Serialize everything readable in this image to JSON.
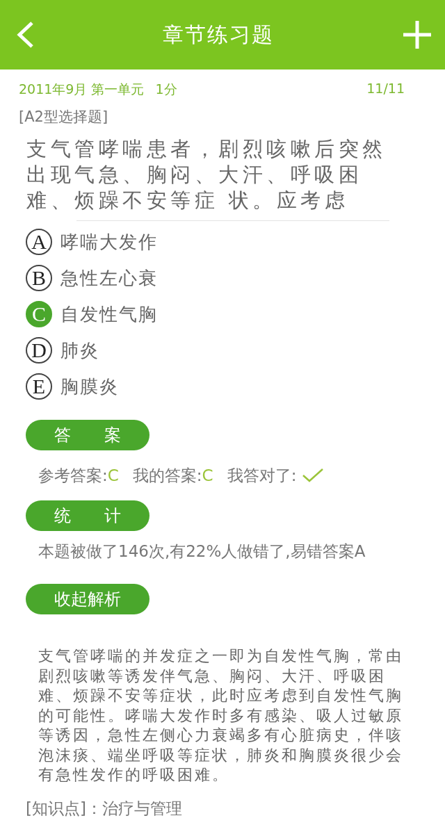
{
  "header": {
    "title": "章节练习题"
  },
  "meta": {
    "date_unit": "2011年9月 第一单元",
    "score": "1分",
    "progress": "11/11"
  },
  "question_type": "[A2型选择题]",
  "question": "支气管哮喘患者，剧烈咳嗽后突然出现气急、胸闷、大汗、呼吸困难、烦躁不安等症 状。应考虑",
  "options": [
    {
      "letter": "A",
      "text": "哮喘大发作",
      "selected": false
    },
    {
      "letter": "B",
      "text": "急性左心衰",
      "selected": false
    },
    {
      "letter": "C",
      "text": "自发性气胸",
      "selected": true
    },
    {
      "letter": "D",
      "text": "肺炎",
      "selected": false
    },
    {
      "letter": "E",
      "text": "胸膜炎",
      "selected": false
    }
  ],
  "answer_section": {
    "label": "答　　案",
    "reference_label": "参考答案:",
    "reference_value": "C",
    "my_label": "我的答案:",
    "my_value": "C",
    "correct_label": "我答对了:",
    "correct": true
  },
  "stats_section": {
    "label": "统　　计",
    "text": "本题被做了146次,有22%人做错了,易错答案A"
  },
  "collapse_button": "收起解析",
  "explanation": "支气管哮喘的并发症之一即为自发性气胸，常由剧烈咳嗽等诱发伴气急、胸闷、大汗、呼吸困难、烦躁不安等症状，此时应考虑到自发性气胸的可能性。哮喘大发作时多有感染、吸人过敏原等诱因，急性左侧心力衰竭多有心脏病史，伴咳泡沫痰、端坐呼吸等症状，肺炎和胸膜炎很少会有急性发作的呼吸困难。",
  "knowledge_point": "[知识点]：治疗与管理"
}
